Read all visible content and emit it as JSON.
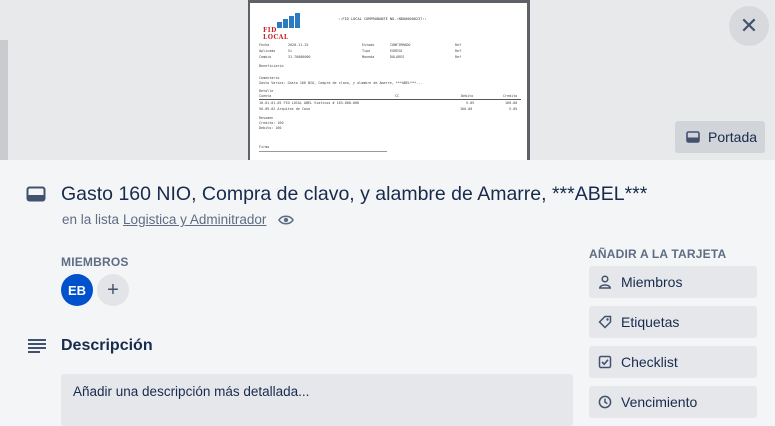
{
  "cover": {
    "doc_logo_text": "FID LOCAL",
    "doc_header": "::FID LOCAL COMPROBANTE NO.:ND000000237::",
    "doc_fields": [
      [
        "Fecha",
        "2020-11-25",
        "Estado",
        "CONFIRMADO",
        "Ref"
      ],
      [
        "Aplicado",
        "Si",
        "Tipo",
        "EGRESO",
        "Ref"
      ],
      [
        "Cambio",
        "31.70000000",
        "Moneda",
        "DOLARES",
        "Ref"
      ]
    ],
    "doc_beneficiario": "Beneficiario",
    "doc_comentario_label": "Comentario",
    "doc_comentario": "Gasto Varios: Gasto 160 NIO, Compra de clavo, y alambre de Amarre, ***ABEL***...",
    "doc_detalle_label": "Detalle",
    "doc_detalle_cols": [
      "Cuenta",
      "CC",
      "Debito",
      "Credito"
    ],
    "doc_detalle_rows": [
      [
        "10-01-01-05 FID LOCAL ABEL Viaticos # 163-000-000",
        "5.05",
        "160.00"
      ],
      [
        "50-09-02 Arquitos de Casa",
        "160.00",
        "5.05"
      ]
    ],
    "doc_resumen_label": "Resumen",
    "doc_resumen": [
      "Credito:   160",
      "Debito:    160"
    ],
    "doc_firma": "Firma",
    "portada_label": "Portada"
  },
  "card": {
    "title": "Gasto 160 NIO, Compra de clavo, y alambre de Amarre, ***ABEL***",
    "list_prefix": "en la lista",
    "list_name": "Logistica y Adminitrador"
  },
  "members": {
    "label": "MIEMBROS",
    "avatar_initials": "EB",
    "add_symbol": "+"
  },
  "description": {
    "title": "Descripción",
    "placeholder": "Añadir una descripción más detallada..."
  },
  "sidebar": {
    "label": "AÑADIR A LA TARJETA",
    "items": [
      {
        "label": "Miembros",
        "icon": "user-icon"
      },
      {
        "label": "Etiquetas",
        "icon": "tag-icon"
      },
      {
        "label": "Checklist",
        "icon": "checklist-icon"
      },
      {
        "label": "Vencimiento",
        "icon": "clock-icon"
      }
    ]
  },
  "colors": {
    "avatar": "#0052cc",
    "cover_bg": "#5e6167",
    "body_bg": "#f4f5f7"
  }
}
